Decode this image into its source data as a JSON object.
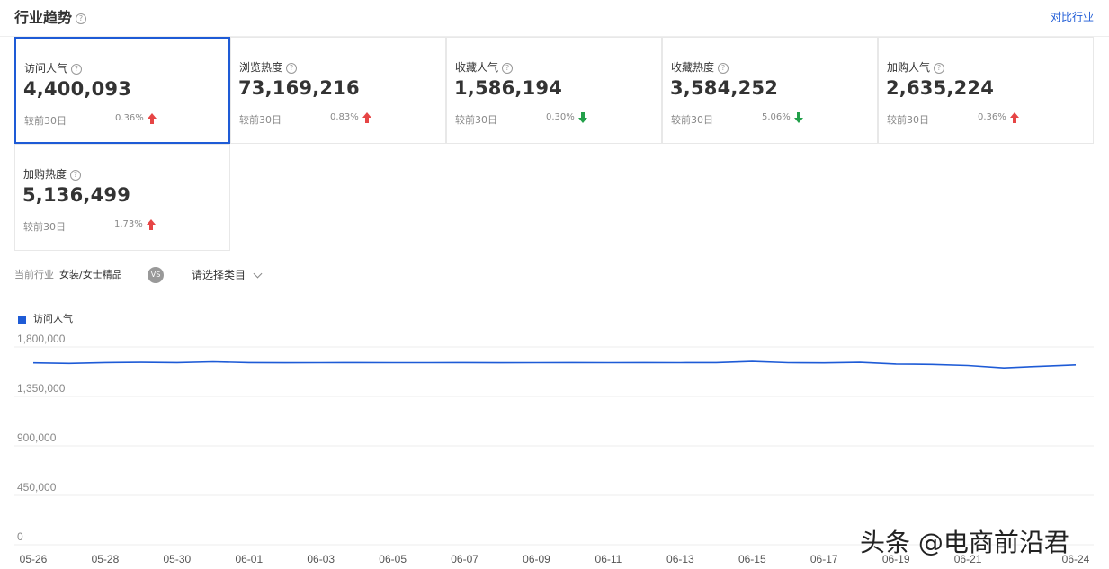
{
  "header": {
    "title": "行业趋势",
    "help_icon": "?",
    "compare_label": "对比行业"
  },
  "metrics": [
    {
      "label": "访问人气",
      "value": "4,400,093",
      "compare": "较前30日",
      "pct": "0.36%",
      "trend": "up"
    },
    {
      "label": "浏览热度",
      "value": "73,169,216",
      "compare": "较前30日",
      "pct": "0.83%",
      "trend": "up"
    },
    {
      "label": "收藏人气",
      "value": "1,586,194",
      "compare": "较前30日",
      "pct": "0.30%",
      "trend": "down"
    },
    {
      "label": "收藏热度",
      "value": "3,584,252",
      "compare": "较前30日",
      "pct": "5.06%",
      "trend": "down"
    },
    {
      "label": "加购人气",
      "value": "2,635,224",
      "compare": "较前30日",
      "pct": "0.36%",
      "trend": "up"
    },
    {
      "label": "加购热度",
      "value": "5,136,499",
      "compare": "较前30日",
      "pct": "1.73%",
      "trend": "up"
    }
  ],
  "filters": {
    "current_label": "当前行业",
    "current_value": "女装/女士精品",
    "vs_label": "VS",
    "select_placeholder": "请选择类目"
  },
  "colors": {
    "accent": "#1e5bd6",
    "up": "#e64545",
    "down": "#22a04a"
  },
  "chart_data": {
    "type": "line",
    "legend": [
      "访问人气"
    ],
    "ylim": [
      0,
      1800000
    ],
    "yticks": [
      "1,800,000",
      "1,350,000",
      "900,000",
      "450,000",
      "0"
    ],
    "ytick_values": [
      1800000,
      1350000,
      900000,
      450000,
      0
    ],
    "xtick_labels": [
      "05-26",
      "05-28",
      "05-30",
      "06-01",
      "06-03",
      "06-05",
      "06-07",
      "06-09",
      "06-11",
      "06-13",
      "06-15",
      "06-17",
      "06-19",
      "06-21",
      "06-24"
    ],
    "series": [
      {
        "name": "访问人气",
        "values": [
          1655000,
          1650000,
          1658000,
          1660000,
          1658000,
          1665000,
          1658000,
          1656000,
          1657000,
          1658000,
          1657000,
          1657000,
          1658000,
          1656000,
          1657000,
          1658000,
          1657000,
          1658000,
          1657000,
          1658000,
          1668000,
          1657000,
          1655000,
          1660000,
          1645000,
          1642000,
          1632000,
          1610000,
          1625000,
          1638000
        ]
      }
    ]
  },
  "watermark": "头条 @电商前沿君"
}
